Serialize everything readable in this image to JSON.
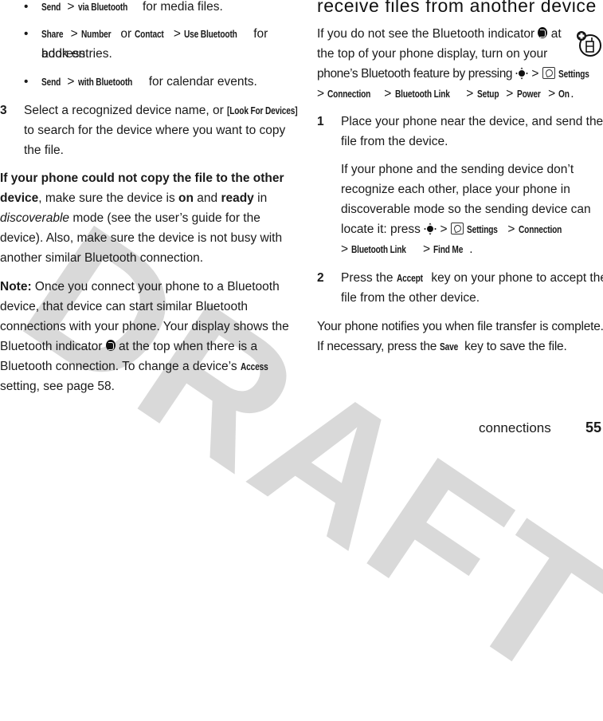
{
  "watermark": "DRAFT",
  "left_column": {
    "bullets": [
      {
        "parts": [
          {
            "key": "Send"
          },
          {
            "text": " > "
          },
          {
            "key": "via Bluetooth"
          },
          {
            "text": " for media files."
          }
        ]
      },
      {
        "line1": [
          {
            "key": "Share"
          },
          {
            "text": " > "
          },
          {
            "key": "Number"
          },
          {
            "text": " or "
          },
          {
            "key": "Contact"
          },
          {
            "text": " > "
          },
          {
            "key": "Use Bluetooth"
          },
          {
            "text": " for address"
          }
        ],
        "line2": "book entries."
      },
      {
        "parts": [
          {
            "key": "Send"
          },
          {
            "text": " > "
          },
          {
            "key": "with Bluetooth"
          },
          {
            "text": " for calendar events."
          }
        ]
      }
    ],
    "step3": {
      "number": "3",
      "line1_text": "Select a recognized device name, or ",
      "line1_key": "[Look For Devices]",
      "line2": "to search for the device where you want to copy",
      "line3": "the file."
    },
    "troubleshoot": {
      "bold_lead_1": "If your phone could not copy the file to the other",
      "bold_lead_2": "device",
      "t1": ", make sure the device is ",
      "on": "on",
      "t2": " and ",
      "ready": "ready",
      "t3": " in",
      "italic": "discoverable",
      "t4": " mode (see the user’s guide for the",
      "line4": "device). Also, make sure the device is not busy with",
      "line5": "another similar Bluetooth connection."
    },
    "note": {
      "label": "Note:",
      "line1": " Once you connect your phone to a Bluetooth",
      "line2": "device, that device can start similar Bluetooth",
      "line3": "connections with your phone. Your display shows the",
      "line4a": "Bluetooth indicator ",
      "line4b": " at the top when there is a",
      "line5a": "Bluetooth connection. To change a device’s ",
      "line5_key": "Access",
      "line6": "setting, see page 58."
    }
  },
  "right_column": {
    "heading": "receive files from another device",
    "intro": {
      "line1a": "If you do not see the Bluetooth indicator ",
      "line1b": " at",
      "line2": "the top of your phone display, turn on your",
      "line3a": "phone’s Bluetooth feature by pressing ",
      "line3b": " > ",
      "line3_key": "Settings",
      "path": [
        "Connection",
        "Bluetooth Link",
        "Setup",
        "Power",
        "On"
      ]
    },
    "step1": {
      "number": "1",
      "line1": "Place your phone near the device, and send the",
      "line2": "file from the device.",
      "sub1": "If your phone and the sending device don’t",
      "sub2": "recognize each other, place your phone in",
      "sub3": "discoverable mode so the sending device can",
      "sub4a": "locate it: press ",
      "sub4_keys": [
        "Settings",
        "Connection"
      ],
      "sub5_keys": [
        "Bluetooth Link",
        "Find Me"
      ]
    },
    "step2": {
      "number": "2",
      "line1a": "Press the ",
      "line1_key": "Accept",
      "line1b": " key on your phone to accept the",
      "line2": "file from the other device."
    },
    "outro": {
      "line1": "Your phone notifies you when file transfer is complete.",
      "line2a": "If necessary, press the ",
      "line2_key": "Save",
      "line2b": " key to save the file."
    }
  },
  "footer": {
    "section": "connections",
    "page": "55"
  },
  "icons": {
    "bluetooth_indicator": "bluetooth-icon",
    "nav_key": "nav-key-icon",
    "settings": "settings-icon",
    "feature_badge": "phone-feature-icon"
  }
}
